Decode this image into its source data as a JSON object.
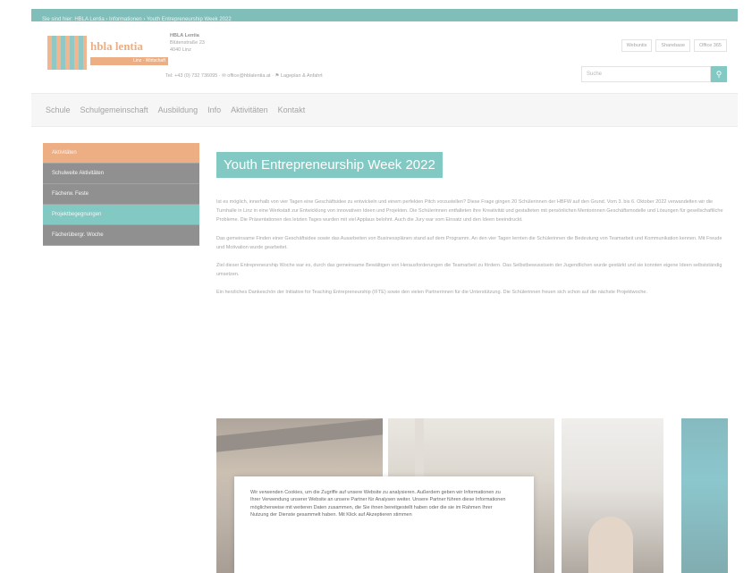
{
  "topbar": {
    "breadcrumb": "Sie sind hier: HBLA Lentia › Informationen › Youth Entrepreneurship Week 2022"
  },
  "header": {
    "logo": {
      "name": "hbla lentia",
      "subtitle": "Linz · Wirtschaft"
    },
    "address": {
      "name": "HBLA Lentia",
      "street": "Blütenstraße 23",
      "city": "4040 Linz"
    },
    "contact": "Tel: +43 (0) 732 736095 · ✉ office@hblalentia.at · ⚑ Lageplan & Anfahrt",
    "toplinks": [
      "Webuntis",
      "Sharebase",
      "Office 365"
    ],
    "search": {
      "placeholder": "Suche",
      "icon": "search-icon"
    }
  },
  "nav": {
    "items": [
      "Schule",
      "Schulgemeinschaft",
      "Ausbildung",
      "Info",
      "Aktivitäten",
      "Kontakt"
    ]
  },
  "sidemenu": {
    "items": [
      {
        "label": "Aktivitäten",
        "state": "head"
      },
      {
        "label": "Schulweite Aktivitäten",
        "state": "normal"
      },
      {
        "label": "Fächerw. Feste",
        "state": "normal"
      },
      {
        "label": "Projektbegegnungen",
        "state": "active"
      },
      {
        "label": "Fächerübergr. Woche",
        "state": "normal"
      }
    ]
  },
  "main": {
    "title": "Youth Entrepreneurship Week 2022",
    "paragraphs": [
      "Ist es möglich, innerhalb von vier Tagen eine Geschäftsidee zu entwickeln und einem perfekten Pitch vorzustellen? Diese Frage gingen 20 Schülerinnen der HBFW auf den Grund. Vom 3. bis 6. Oktober 2022 verwandelten wir die Turnhalle in Linz in eine Werkstatt zur Entwicklung von innovativen Ideen und Projekten. Die Schülerinnen entfalteten ihre Kreativität und gestalteten mit persönlichen Mentorinnen Geschäftsmodelle und Lösungen für gesellschaftliche Probleme. Die Präsentationen des letzten Tages wurden mit viel Applaus belohnt. Auch die Jury war vom Einsatz und den Ideen beeindruckt.",
      "Das gemeinsame Finden einer Geschäftsidee sowie das Ausarbeiten von Businessplänen stand auf dem Programm. An den vier Tagen lernten die Schülerinnen die Bedeutung von Teamarbeit und Kommunikation kennen. Mit Freude und Motivation wurde gearbeitet.",
      "Ziel dieser Entrepreneurship Woche war es, durch das gemeinsame Bewältigen von Herausforderungen die Teamarbeit zu fördern. Das Selbstbewusstsein der Jugendlichen wurde gestärkt und sie konnten eigene Ideen selbstständig umsetzen.",
      "Ein herzliches Dankeschön der Initiative for Teaching Entrepreneurship (IFTE) sowie den vielen Partnerinnen für die Unterstützung. Die Schülerinnen freuen sich schon auf die nächste Projektwoche."
    ]
  },
  "cookie": {
    "text": "Wir verwenden Cookies, um die Zugriffe auf unsere Website zu analysieren. Außerdem geben wir Informationen zu Ihrer Verwendung unserer Website an unsere Partner für Analysen weiter. Unsere Partner führen diese Informationen möglicherweise mit weiteren Daten zusammen, die Sie ihnen bereitgestellt haben oder die sie im Rahmen Ihrer Nutzung der Dienste gesammelt haben. Mit Klick auf Akzeptieren stimmen"
  },
  "colors": {
    "teal": "#1a9b91",
    "orange": "#e06a1a",
    "dark": "#333333"
  }
}
